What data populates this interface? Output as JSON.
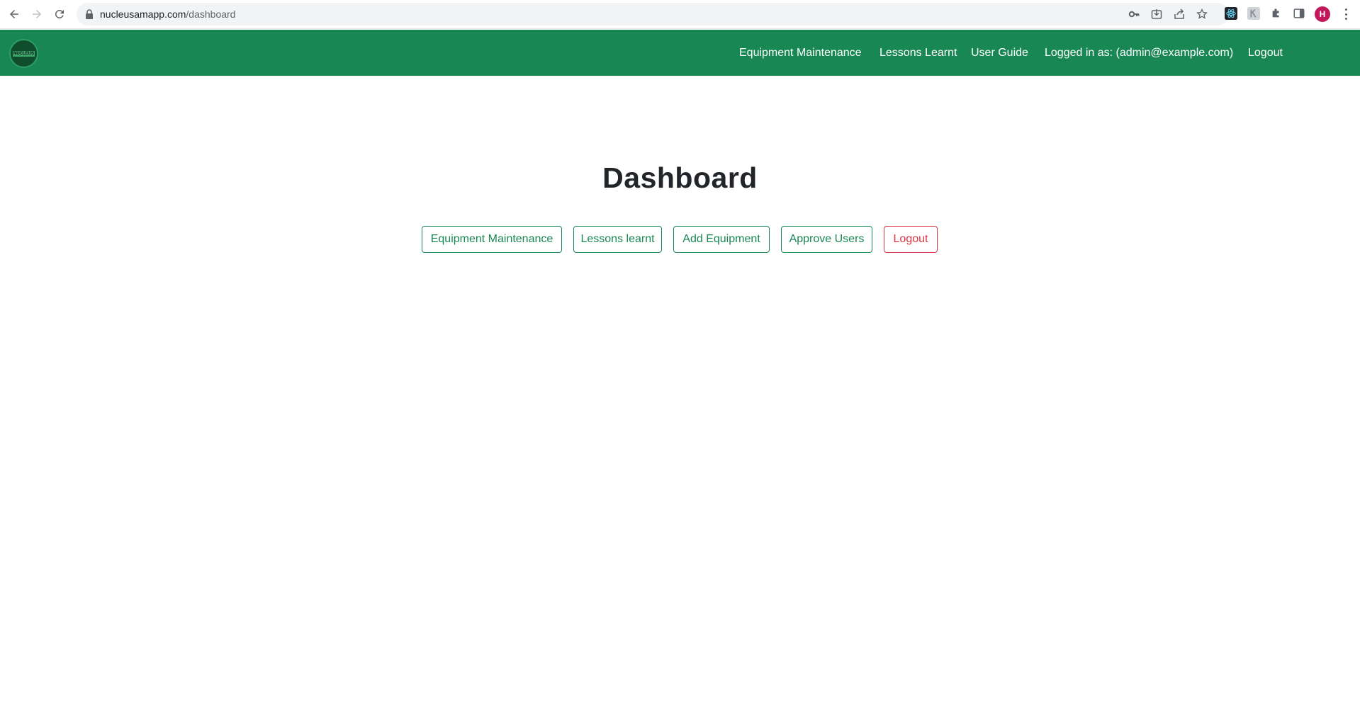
{
  "browser": {
    "url_host": "nucleusamapp.com",
    "url_path": "/dashboard",
    "profile_initial": "H",
    "icons": [
      "back-icon",
      "forward-icon",
      "reload-icon",
      "lock-icon",
      "key-icon",
      "install-icon",
      "share-icon",
      "star-icon",
      "react-devtools-icon",
      "extension-k-icon",
      "puzzle-icon",
      "side-panel-icon",
      "menu-icon"
    ]
  },
  "navbar": {
    "background": "#198754",
    "logo_text": "NUCLEUS",
    "links": [
      {
        "id": "equipment-maintenance",
        "label": "Equipment Maintenance"
      },
      {
        "id": "lessons-learnt",
        "label": "Lessons Learnt"
      },
      {
        "id": "user-guide",
        "label": "User Guide"
      },
      {
        "id": "logged-in-as",
        "label": "Logged in as: (admin@example.com)"
      },
      {
        "id": "logout",
        "label": "Logout"
      }
    ]
  },
  "main": {
    "title": "Dashboard",
    "buttons": [
      {
        "label": "Equipment Maintenance",
        "color": "#198754"
      },
      {
        "label": "Lessons learnt",
        "color": "#198754"
      },
      {
        "label": "Add Equipment",
        "color": "#198754"
      },
      {
        "label": "Approve Users",
        "color": "#198754"
      },
      {
        "label": "Logout",
        "color": "#dc3545"
      }
    ]
  }
}
